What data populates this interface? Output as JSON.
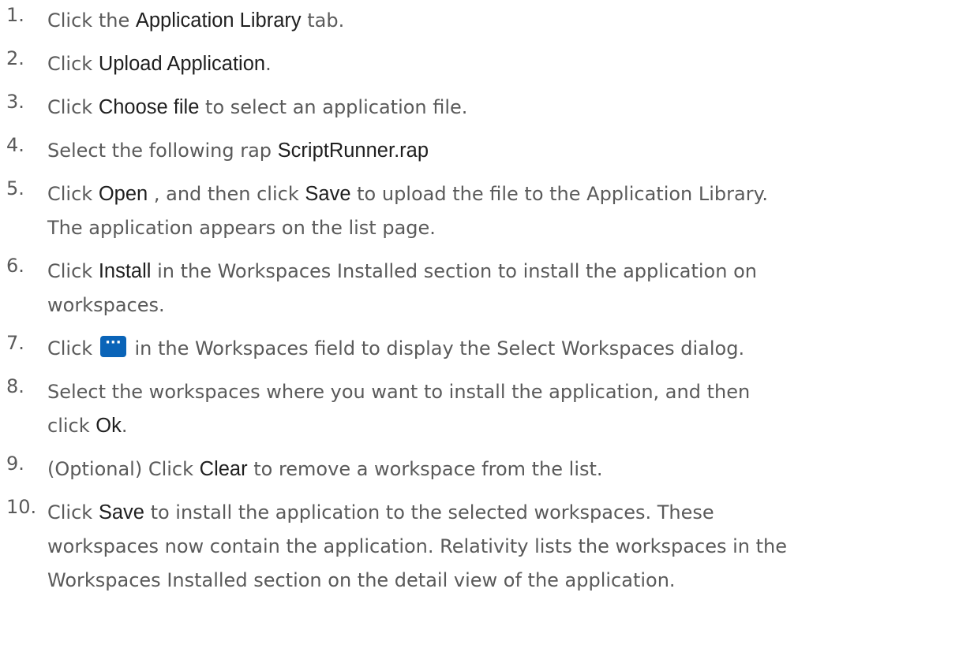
{
  "steps": [
    {
      "num": "1.",
      "lines": [
        {
          "a": "Click the ",
          "b": "Application Library",
          "c": " tab."
        }
      ]
    },
    {
      "num": "2.",
      "lines": [
        {
          "a": "Click ",
          "b": "Upload Application",
          "c": "."
        }
      ]
    },
    {
      "num": "3.",
      "lines": [
        {
          "a": "Click ",
          "b": "Choose file",
          "c": " to select an application file."
        }
      ]
    },
    {
      "num": "4.",
      "lines": [
        {
          "a": "Select the following rap ",
          "b": "ScriptRunner.rap"
        }
      ]
    },
    {
      "num": "5.",
      "lines": [
        {
          "a": "Click ",
          "b": "Open",
          "c": " , and then click ",
          "d": "Save",
          "e": " to upload the file to the Application Library."
        },
        {
          "a": "The application appears on the list page."
        }
      ]
    },
    {
      "num": "6.",
      "lines": [
        {
          "a": "Click ",
          "b": "Install",
          "c": " in the Workspaces Installed section to install the application on"
        },
        {
          "a": "workspaces."
        }
      ]
    },
    {
      "num": "7.",
      "lines": [
        {
          "a": "Click ",
          "icon": "ellipsis-button-icon",
          "c": " in the Workspaces field to display the Select Workspaces dialog."
        }
      ]
    },
    {
      "num": "8.",
      "lines": [
        {
          "a": "Select the workspaces where you want to install the application, and then"
        },
        {
          "a": "click ",
          "b": "Ok",
          "c": "."
        }
      ]
    },
    {
      "num": "9.",
      "lines": [
        {
          "a": "(Optional) Click ",
          "b": "Clear",
          "c": " to remove a workspace from the list."
        }
      ]
    },
    {
      "num": "10.",
      "lines": [
        {
          "a": "Click ",
          "b": "Save",
          "c": " to install the application to the selected workspaces. These"
        },
        {
          "a": "workspaces now contain the application. Relativity lists the workspaces in the"
        },
        {
          "a": "Workspaces Installed section on the detail view of the application."
        }
      ]
    }
  ],
  "icons": {
    "ellipsis_glyph": "···",
    "ellipsis_color": "#0a64b8"
  }
}
